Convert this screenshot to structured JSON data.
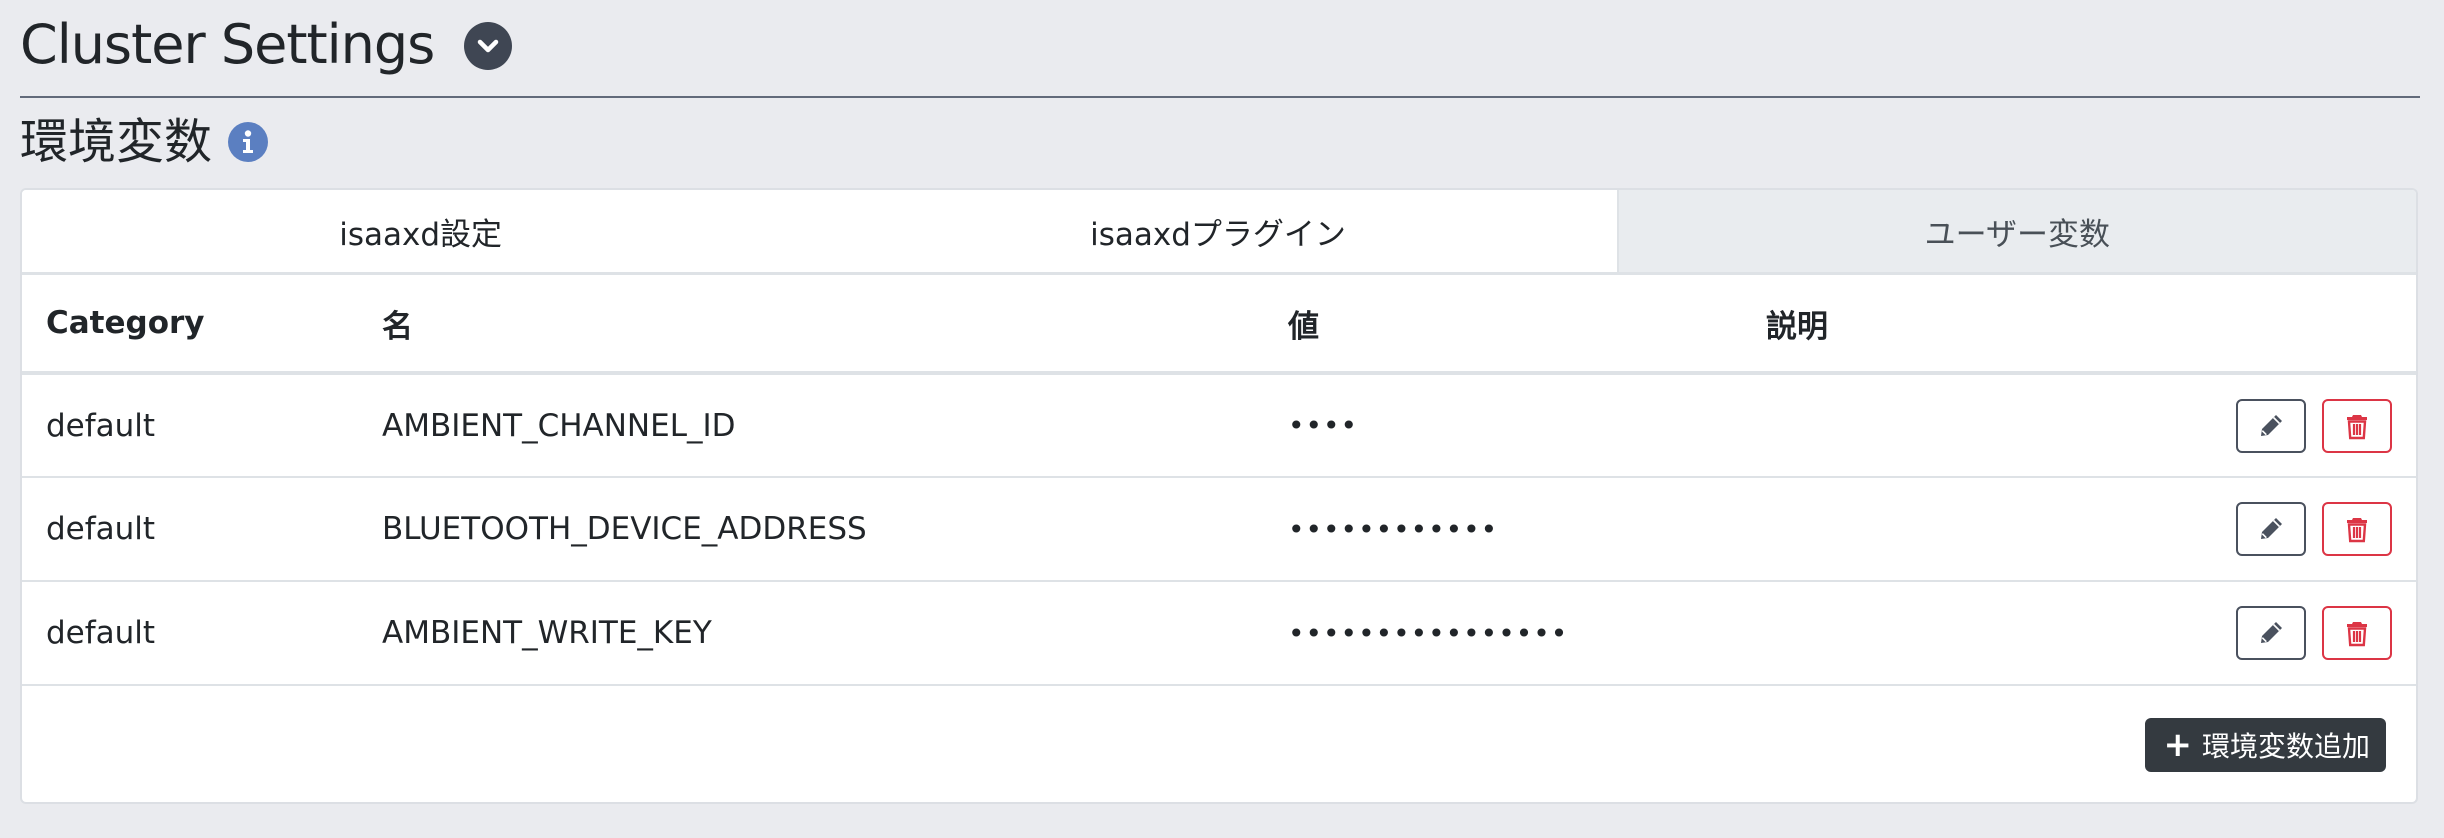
{
  "page": {
    "title": "Cluster Settings"
  },
  "section": {
    "title": "環境変数"
  },
  "tabs": [
    {
      "label": "isaaxd設定",
      "active": true
    },
    {
      "label": "isaaxdプラグイン",
      "active": true
    },
    {
      "label": "ユーザー変数",
      "active": false
    }
  ],
  "table": {
    "headers": [
      "Category",
      "名",
      "値",
      "説明"
    ],
    "rows": [
      {
        "category": "default",
        "name": "AMBIENT_CHANNEL_ID",
        "value": "••••",
        "description": ""
      },
      {
        "category": "default",
        "name": "BLUETOOTH_DEVICE_ADDRESS",
        "value": "••••••••••••",
        "description": ""
      },
      {
        "category": "default",
        "name": "AMBIENT_WRITE_KEY",
        "value": "••••••••••••••••",
        "description": ""
      }
    ]
  },
  "add_button": {
    "plus": "+",
    "label": "環境変数追加"
  },
  "icons": {
    "toggle": "chevron-down-icon",
    "info": "info-icon",
    "edit": "pencil-icon",
    "delete": "trash-icon"
  },
  "colors": {
    "background": "#eaebef",
    "dark": "#343a40",
    "danger": "#dc3545",
    "info": "#5b7fc1"
  }
}
